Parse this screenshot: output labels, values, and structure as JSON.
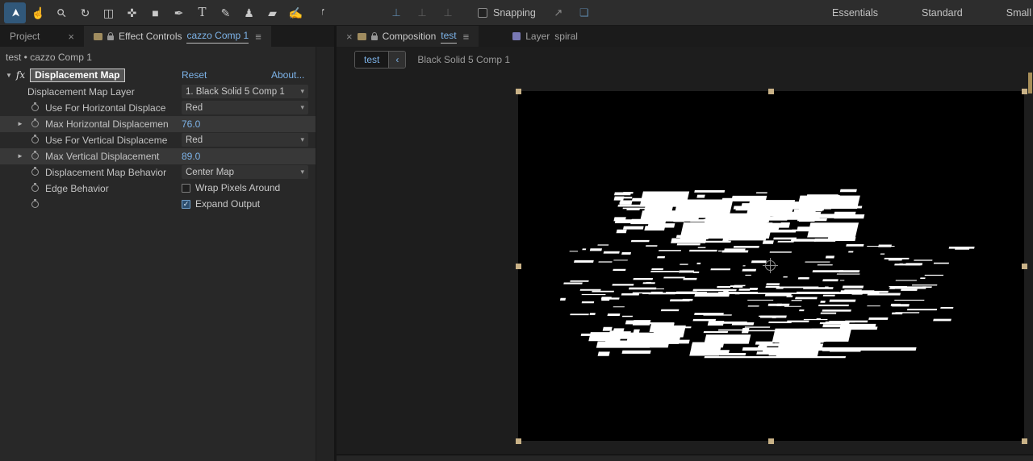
{
  "colors": {
    "accent": "#7db3e8",
    "canvas_bg": "#000000",
    "handle": "#c9b287",
    "active_tool_bg": "#31587a"
  },
  "toolbar": {
    "tools": [
      {
        "name": "selection-tool",
        "glyph": "➤",
        "active": true
      },
      {
        "name": "hand-tool",
        "glyph": "☝",
        "active": false
      },
      {
        "name": "zoom-tool",
        "glyph": "⚲",
        "active": false
      },
      {
        "name": "rotation-tool",
        "glyph": "↻",
        "active": false
      },
      {
        "name": "camera-tool",
        "glyph": "◫",
        "active": false
      },
      {
        "name": "pan-behind-tool",
        "glyph": "✜",
        "active": false
      },
      {
        "name": "rectangle-tool",
        "glyph": "■",
        "active": false
      },
      {
        "name": "pen-tool",
        "glyph": "✒",
        "active": false
      },
      {
        "name": "type-tool",
        "glyph": "T",
        "active": false
      },
      {
        "name": "brush-tool",
        "glyph": "✎",
        "active": false
      },
      {
        "name": "clone-stamp-tool",
        "glyph": "♟",
        "active": false
      },
      {
        "name": "eraser-tool",
        "glyph": "▰",
        "active": false
      },
      {
        "name": "roto-brush-tool",
        "glyph": "✍",
        "active": false
      },
      {
        "name": "puppet-pin-tool",
        "glyph": "♩",
        "active": false
      }
    ],
    "axis_buttons": [
      {
        "name": "local-axis-mode-button",
        "glyph": "⊥",
        "tinted": true
      },
      {
        "name": "world-axis-mode-button",
        "glyph": "⊥",
        "tinted": false
      },
      {
        "name": "view-axis-mode-button",
        "glyph": "⊥",
        "tinted": false
      }
    ],
    "snapping": {
      "label": "Snapping",
      "checked": false
    },
    "snap_options": [
      {
        "name": "snap-beyond-edges-button",
        "glyph": "↗",
        "tinted": false
      },
      {
        "name": "snap-internal-wireframes-button",
        "glyph": "❏",
        "tinted": true
      }
    ],
    "workspaces": [
      {
        "label": "Essentials"
      },
      {
        "label": "Standard"
      },
      {
        "label": "Small"
      }
    ]
  },
  "left_panel": {
    "project_tab": {
      "label": "Project",
      "close": "×"
    },
    "effect_controls_tab": {
      "label": "Effect Controls",
      "comp": "cazzo Comp 1",
      "menu": "≡"
    },
    "subtitle": "test • cazzo Comp 1",
    "effect": {
      "disclosure": "▼",
      "fx_badge": "fx",
      "name": "Displacement Map",
      "reset_label": "Reset",
      "about_label": "About...",
      "rows": [
        {
          "label": "Displacement Map Layer",
          "type": "dropdown",
          "value": "1. Black Solid 5 Comp 1",
          "stopwatch": false,
          "expand": false,
          "highlight": false
        },
        {
          "label": "Use For Horizontal Displace",
          "type": "dropdown",
          "value": "Red",
          "stopwatch": true,
          "expand": false,
          "highlight": false
        },
        {
          "label": "Max Horizontal Displacemen",
          "type": "value",
          "value": "76.0",
          "stopwatch": true,
          "expand": true,
          "highlight": true
        },
        {
          "label": "Use For Vertical Displaceme",
          "type": "dropdown",
          "value": "Red",
          "stopwatch": true,
          "expand": false,
          "highlight": false
        },
        {
          "label": "Max Vertical Displacement",
          "type": "value",
          "value": "89.0",
          "stopwatch": true,
          "expand": true,
          "highlight": true
        },
        {
          "label": "Displacement Map Behavior",
          "type": "dropdown",
          "value": "Center Map",
          "stopwatch": true,
          "expand": false,
          "highlight": false
        },
        {
          "label": "Edge Behavior",
          "type": "checkbox",
          "value": "Wrap Pixels Around",
          "checked": false,
          "stopwatch": true,
          "expand": false,
          "highlight": false
        },
        {
          "label": "",
          "type": "checkbox",
          "value": "Expand Output",
          "checked": true,
          "stopwatch": true,
          "expand": false,
          "highlight": false
        }
      ]
    }
  },
  "viewer": {
    "composition_tab": {
      "close": "×",
      "label": "Composition",
      "comp": "test",
      "menu": "≡"
    },
    "layer_tab": {
      "label": "Layer",
      "comp": "spiral"
    },
    "breadcrumb": {
      "current": "test",
      "back": "‹",
      "parent": "Black Solid 5 Comp 1"
    }
  }
}
